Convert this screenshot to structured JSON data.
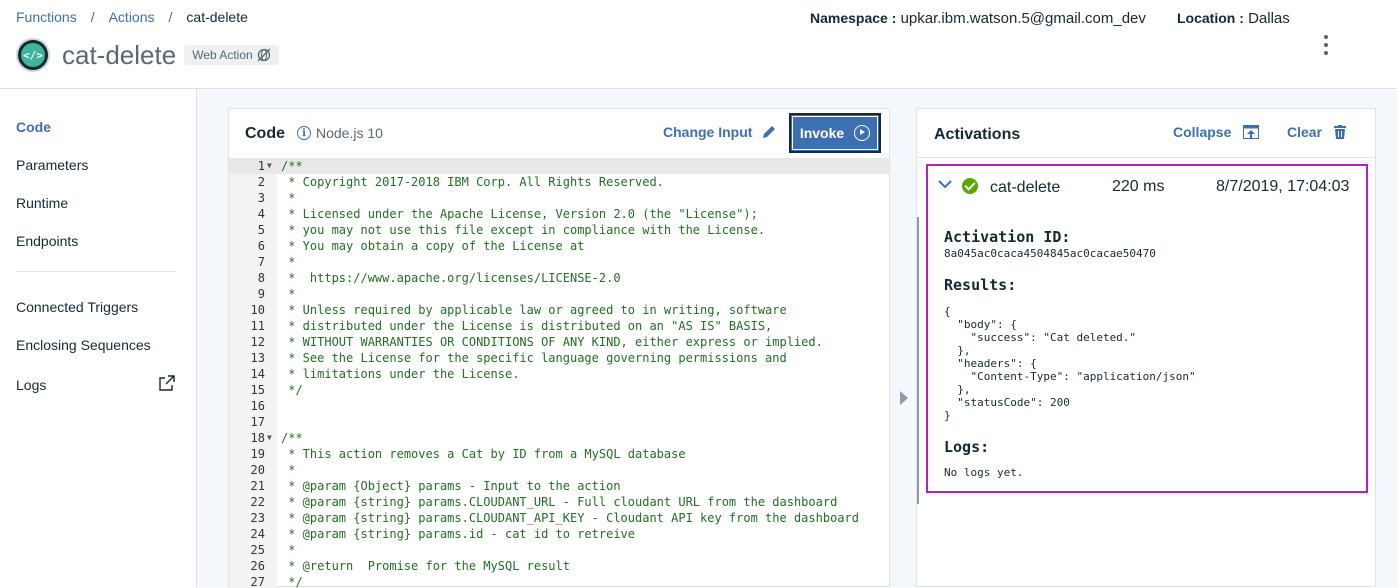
{
  "breadcrumb": {
    "functions": "Functions",
    "actions": "Actions",
    "current": "cat-delete",
    "sep": "/"
  },
  "header": {
    "title": "cat-delete",
    "web_badge": "Web Action",
    "namespace_label": "Namespace :",
    "namespace_value": "upkar.ibm.watson.5@gmail.com_dev",
    "location_label": "Location :",
    "location_value": "Dallas",
    "icon_glyph": "</>"
  },
  "sidebar": {
    "items": [
      {
        "label": "Code",
        "active": true
      },
      {
        "label": "Parameters"
      },
      {
        "label": "Runtime"
      },
      {
        "label": "Endpoints"
      },
      {
        "label": "Connected Triggers"
      },
      {
        "label": "Enclosing Sequences"
      },
      {
        "label": "Logs"
      }
    ]
  },
  "code_panel": {
    "title": "Code",
    "runtime": "Node.js 10",
    "change_input": "Change Input",
    "invoke": "Invoke",
    "lines": [
      "/**",
      " * Copyright 2017-2018 IBM Corp. All Rights Reserved.",
      " *",
      " * Licensed under the Apache License, Version 2.0 (the \"License\");",
      " * you may not use this file except in compliance with the License.",
      " * You may obtain a copy of the License at",
      " *",
      " *  https://www.apache.org/licenses/LICENSE-2.0",
      " *",
      " * Unless required by applicable law or agreed to in writing, software",
      " * distributed under the License is distributed on an \"AS IS\" BASIS,",
      " * WITHOUT WARRANTIES OR CONDITIONS OF ANY KIND, either express or implied.",
      " * See the License for the specific language governing permissions and",
      " * limitations under the License.",
      " */",
      "",
      "",
      "/**",
      " * This action removes a Cat by ID from a MySQL database",
      " *",
      " * @param {Object} params - Input to the action",
      " * @param {string} params.CLOUDANT_URL - Full cloudant URL from the dashboard",
      " * @param {string} params.CLOUDANT_API_KEY - Cloudant API key from the dashboard",
      " * @param {string} params.id - cat id to retreive",
      " *",
      " * @return  Promise for the MySQL result",
      " */"
    ],
    "fold_lines": [
      1,
      18
    ]
  },
  "activations": {
    "title": "Activations",
    "collapse": "Collapse",
    "clear": "Clear",
    "item": {
      "name": "cat-delete",
      "duration": "220 ms",
      "date": "8/7/2019, 17:04:03",
      "activation_id_label": "Activation ID:",
      "activation_id": "8a045ac0caca4504845ac0cacae50470",
      "results_label": "Results:",
      "results": "{\n  \"body\": {\n    \"success\": \"Cat deleted.\"\n  },\n  \"headers\": {\n    \"Content-Type\": \"application/json\"\n  },\n  \"statusCode\": 200\n}",
      "logs_label": "Logs:",
      "logs": "No logs yet."
    }
  }
}
